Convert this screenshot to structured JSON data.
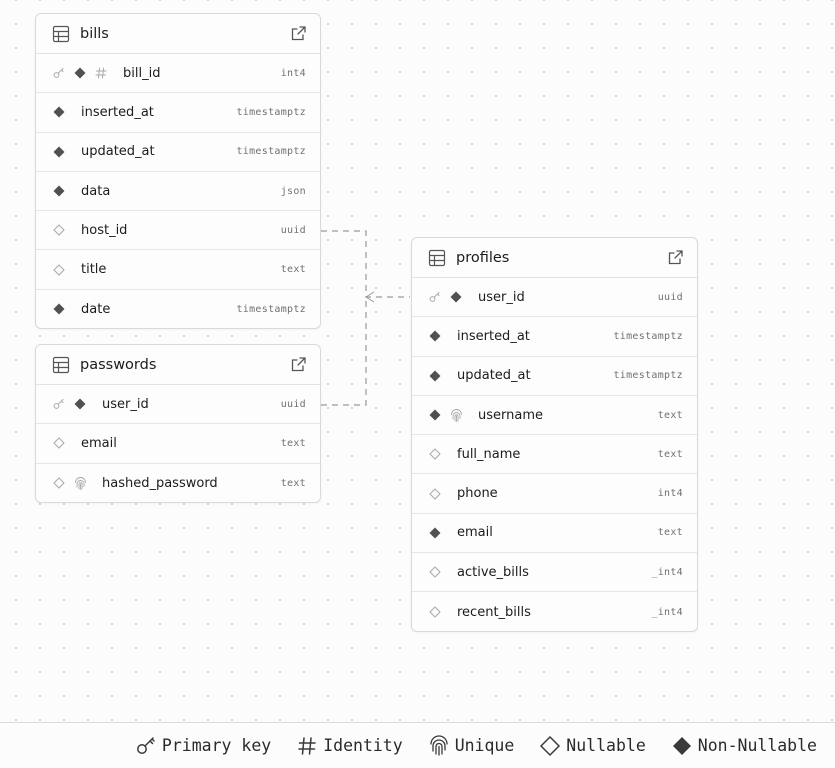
{
  "tables": [
    {
      "name": "bills",
      "columns": [
        {
          "name": "bill_id",
          "type": "int4",
          "icons": [
            "key",
            "filled",
            "hash"
          ]
        },
        {
          "name": "inserted_at",
          "type": "timestamptz",
          "icons": [
            "filled"
          ]
        },
        {
          "name": "updated_at",
          "type": "timestamptz",
          "icons": [
            "filled"
          ]
        },
        {
          "name": "data",
          "type": "json",
          "icons": [
            "filled"
          ]
        },
        {
          "name": "host_id",
          "type": "uuid",
          "icons": [
            "hollow"
          ]
        },
        {
          "name": "title",
          "type": "text",
          "icons": [
            "hollow"
          ]
        },
        {
          "name": "date",
          "type": "timestamptz",
          "icons": [
            "filled"
          ]
        }
      ]
    },
    {
      "name": "passwords",
      "columns": [
        {
          "name": "user_id",
          "type": "uuid",
          "icons": [
            "key",
            "filled"
          ]
        },
        {
          "name": "email",
          "type": "text",
          "icons": [
            "hollow"
          ]
        },
        {
          "name": "hashed_password",
          "type": "text",
          "icons": [
            "hollow",
            "fingerprint"
          ]
        }
      ]
    },
    {
      "name": "profiles",
      "columns": [
        {
          "name": "user_id",
          "type": "uuid",
          "icons": [
            "key",
            "filled"
          ]
        },
        {
          "name": "inserted_at",
          "type": "timestamptz",
          "icons": [
            "filled"
          ]
        },
        {
          "name": "updated_at",
          "type": "timestamptz",
          "icons": [
            "filled"
          ]
        },
        {
          "name": "username",
          "type": "text",
          "icons": [
            "filled",
            "fingerprint"
          ]
        },
        {
          "name": "full_name",
          "type": "text",
          "icons": [
            "hollow"
          ]
        },
        {
          "name": "phone",
          "type": "int4",
          "icons": [
            "hollow"
          ]
        },
        {
          "name": "email",
          "type": "text",
          "icons": [
            "filled"
          ]
        },
        {
          "name": "active_bills",
          "type": "_int4",
          "icons": [
            "hollow"
          ]
        },
        {
          "name": "recent_bills",
          "type": "_int4",
          "icons": [
            "hollow"
          ]
        }
      ]
    }
  ],
  "legend": {
    "primary_key": "Primary key",
    "identity": "Identity",
    "unique": "Unique",
    "nullable": "Nullable",
    "non_nullable": "Non-Nullable"
  },
  "colors": {
    "edge": "#9a9a9a",
    "icon_filled": "#505050",
    "icon_muted": "#a8a8a8"
  }
}
